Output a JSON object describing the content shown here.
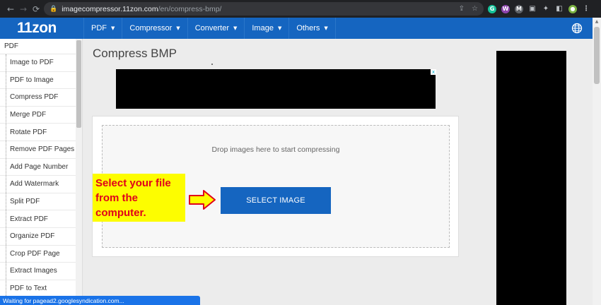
{
  "browser": {
    "url_host": "imagecompressor.11zon.com",
    "url_path": "/en/compress-bmp/",
    "status_text": "Waiting for pagead2.googlesyndication.com...",
    "back_glyph": "←",
    "forward_glyph": "→",
    "reload_glyph": "⟳",
    "lock_glyph": "🔒",
    "omni_icons": [
      "⇪",
      "☆"
    ],
    "extensions": [
      {
        "name": "grammarly",
        "glyph": "G",
        "color": "#15c39a"
      },
      {
        "name": "w-extension",
        "glyph": "W",
        "color": "#8e44ad"
      },
      {
        "name": "gmail",
        "glyph": "M",
        "color": "#5f6368"
      },
      {
        "name": "ext-square",
        "glyph": "▣",
        "color": ""
      },
      {
        "name": "puzzle",
        "glyph": "✦",
        "color": ""
      },
      {
        "name": "sidepanel",
        "glyph": "◧",
        "color": ""
      },
      {
        "name": "profile",
        "glyph": "●",
        "color": "#7cb342"
      },
      {
        "name": "kebab-menu",
        "glyph": "⋮",
        "color": ""
      }
    ]
  },
  "site": {
    "logo": "11zon",
    "menu": [
      {
        "label": "PDF",
        "chevron": "▼"
      },
      {
        "label": "Compressor",
        "chevron": "▼"
      },
      {
        "label": "Converter",
        "chevron": "▼"
      },
      {
        "label": "Image",
        "chevron": "▼"
      },
      {
        "label": "Others",
        "chevron": "▼"
      }
    ],
    "accent": "#1565c0"
  },
  "sidebar": {
    "heading": "PDF",
    "items": [
      "Image to PDF",
      "PDF to Image",
      "Compress PDF",
      "Merge PDF",
      "Rotate PDF",
      "Remove PDF Pages",
      "Add Page Number",
      "Add Watermark",
      "Split PDF",
      "Extract PDF",
      "Organize PDF",
      "Crop PDF Page",
      "Extract Images",
      "PDF to Text"
    ]
  },
  "main": {
    "title": "Compress BMP",
    "drop_text": "Drop images here to start compressing",
    "select_button": "SELECT IMAGE",
    "callout_text": "Select your file from the computer.",
    "callout_bg": "#fdfd00",
    "callout_color": "#e0001b",
    "ad_close": "x"
  }
}
